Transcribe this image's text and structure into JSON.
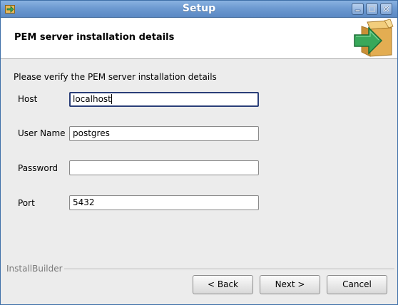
{
  "window": {
    "title": "Setup",
    "controls": {
      "minimize": "minimize-icon",
      "maximize": "maximize-icon",
      "close": "close-icon"
    }
  },
  "header": {
    "title": "PEM server installation details",
    "icon": "install-box-icon"
  },
  "form": {
    "intro": "Please verify the PEM server installation details",
    "host": {
      "label": "Host",
      "value": "localhost"
    },
    "user": {
      "label": "User Name",
      "value": "postgres"
    },
    "password": {
      "label": "Password",
      "value": ""
    },
    "port": {
      "label": "Port",
      "value": "5432"
    }
  },
  "footer": {
    "brand": "InstallBuilder",
    "back_label": "< Back",
    "next_label": "Next >",
    "cancel_label": "Cancel"
  },
  "colors": {
    "titlebar": "#6d9ad1",
    "focus_border": "#2a3e78",
    "icon_green": "#3aa857",
    "icon_box": "#e0b25a"
  }
}
